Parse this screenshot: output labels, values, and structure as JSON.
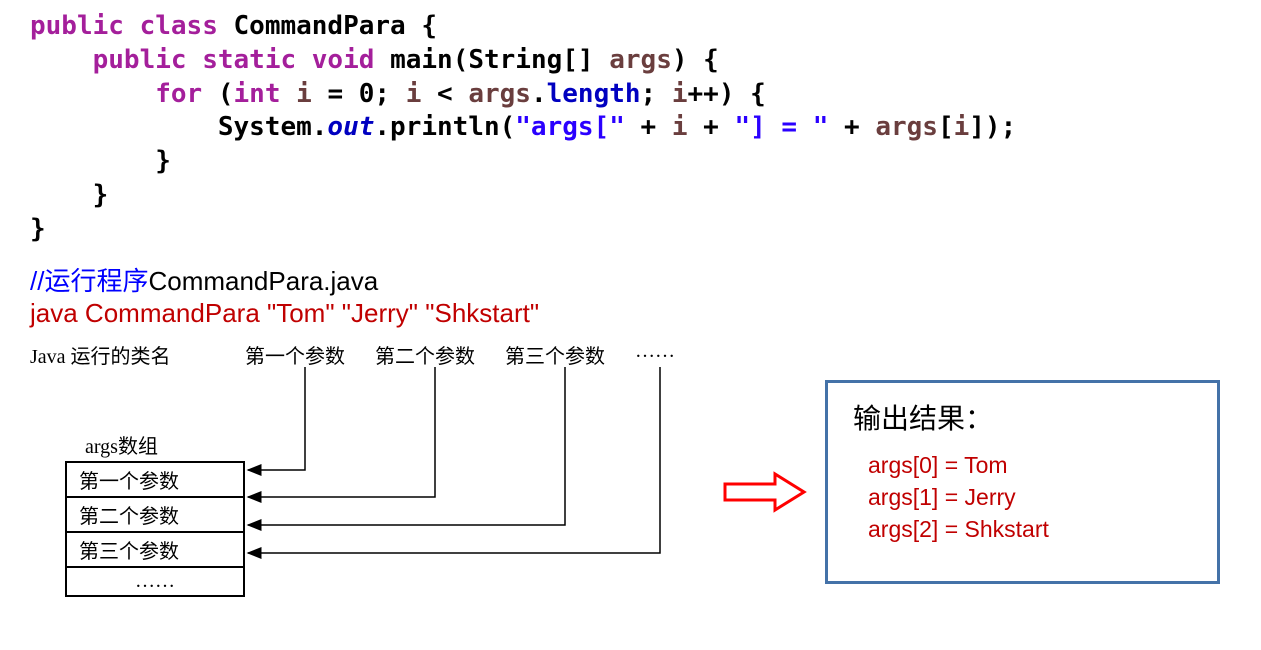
{
  "code": {
    "line1_kw1": "public",
    "line1_kw2": "class",
    "line1_name": "CommandPara",
    "line1_brace": " {",
    "line2_kw1": "public",
    "line2_kw2": "static",
    "line2_kw3": "void",
    "line2_name": "main",
    "line2_sig1": "(String[] ",
    "line2_arg": "args",
    "line2_sig2": ") {",
    "line3_kw1": "for",
    "line3_p1": " (",
    "line3_kw2": "int",
    "line3_p2": " ",
    "line3_var1": "i",
    "line3_p3": " = 0; ",
    "line3_var2": "i",
    "line3_p4": " < ",
    "line3_args": "args",
    "line3_dot": ".",
    "line3_len": "length",
    "line3_p5": "; ",
    "line3_var3": "i",
    "line3_p6": "++) {",
    "line4_sys": "System.",
    "line4_out": "out",
    "line4_prn": ".println(",
    "line4_str1": "\"args[\"",
    "line4_p1": " + ",
    "line4_var1": "i",
    "line4_p2": " + ",
    "line4_str2": "\"] = \"",
    "line4_p3": " + ",
    "line4_args": "args",
    "line4_br1": "[",
    "line4_var2": "i",
    "line4_br2": "]);",
    "line5": "}",
    "line6": "}",
    "line7": "}"
  },
  "comments": {
    "c1_prefix": "//运行程序",
    "c1_filename": "CommandPara.java",
    "cmd": "java CommandPara \"Tom\"  \"Jerry\"  \"Shkstart\""
  },
  "diagram": {
    "label_classname": "Java 运行的类名",
    "label_p1": "第一个参数",
    "label_p2": "第二个参数",
    "label_p3": "第三个参数",
    "label_dots": "……",
    "array_title": "args数组",
    "cell1": "第一个参数",
    "cell2": "第二个参数",
    "cell3": "第三个参数",
    "cell4": "……"
  },
  "output": {
    "title": "输出结果：",
    "line1": "args[0] = Tom",
    "line2": "args[1] = Jerry",
    "line3": "args[2] = Shkstart"
  }
}
